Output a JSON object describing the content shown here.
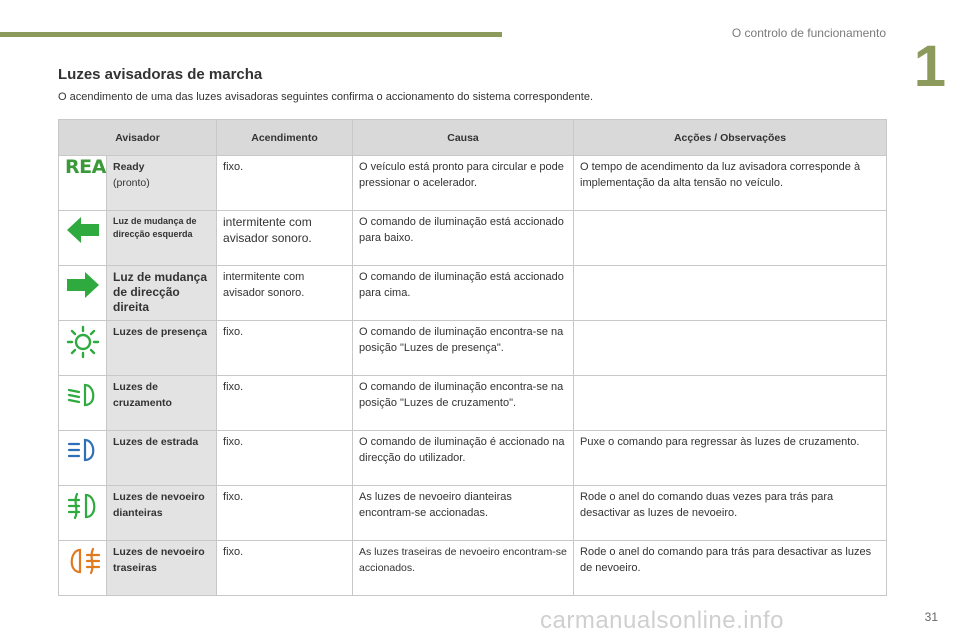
{
  "header": {
    "section_title": "O controlo de funcionamento",
    "chapter_number": "1",
    "page_number": "31"
  },
  "page": {
    "title": "Luzes avisadoras de marcha",
    "intro": "O acendimento de uma das luzes avisadoras seguintes confirma o accionamento do sistema correspondente."
  },
  "table": {
    "headers": [
      "Avisador",
      "Acendimento",
      "Causa",
      "Acções / Observações"
    ],
    "rows": [
      {
        "icon": "ready-icon",
        "icon_text": "READY",
        "name": "Ready",
        "name_sub": "(pronto)",
        "lighting": "fixo.",
        "cause": "O veículo está pronto para circular e pode pressionar o acelerador.",
        "action": "O tempo de acendimento da luz avisadora corresponde à implementação da alta tensão no veículo."
      },
      {
        "icon": "left-turn-arrow-icon",
        "name": "Luz de mudança de direcção esquerda",
        "lighting": "intermitente com avisador sonoro.",
        "cause": "O comando de iluminação está accionado para baixo.",
        "action": ""
      },
      {
        "icon": "right-turn-arrow-icon",
        "name": "Luz de mudança de direcção direita",
        "lighting": "intermitente com avisador sonoro.",
        "cause": "O comando de iluminação está accionado para cima.",
        "action": ""
      },
      {
        "icon": "sidelights-icon",
        "name": "Luzes de presença",
        "lighting": "fixo.",
        "cause": "O comando de iluminação encontra-se na posição \"Luzes de presença\".",
        "action": ""
      },
      {
        "icon": "dipped-beam-icon",
        "name": "Luzes de cruzamento",
        "lighting": "fixo.",
        "cause": "O comando de iluminação encontra-se na posição \"Luzes de cruzamento\".",
        "action": ""
      },
      {
        "icon": "main-beam-icon",
        "name": "Luzes de estrada",
        "lighting": "fixo.",
        "cause": "O comando de iluminação é accionado na direcção do utilizador.",
        "action": "Puxe o comando para regressar às luzes de cruzamento."
      },
      {
        "icon": "front-fog-icon",
        "name": "Luzes de nevoeiro dianteiras",
        "lighting": "fixo.",
        "cause": "As luzes de nevoeiro dianteiras encontram-se accionadas.",
        "action": "Rode o anel do comando duas vezes para trás para desactivar as luzes de nevoeiro."
      },
      {
        "icon": "rear-fog-icon",
        "name": "Luzes de nevoeiro traseiras",
        "lighting": "fixo.",
        "cause": "As luzes traseiras de nevoeiro encontram-se accionados.",
        "action": "Rode o anel do comando para trás para desactivar as luzes de nevoeiro."
      }
    ]
  },
  "colors": {
    "accent_green": "#3a9a3a",
    "header_olive": "#8c9a5b",
    "icon_blue": "#2f6fb7",
    "icon_green": "#2eaa3f"
  },
  "watermark": "carmanualsonline.info"
}
